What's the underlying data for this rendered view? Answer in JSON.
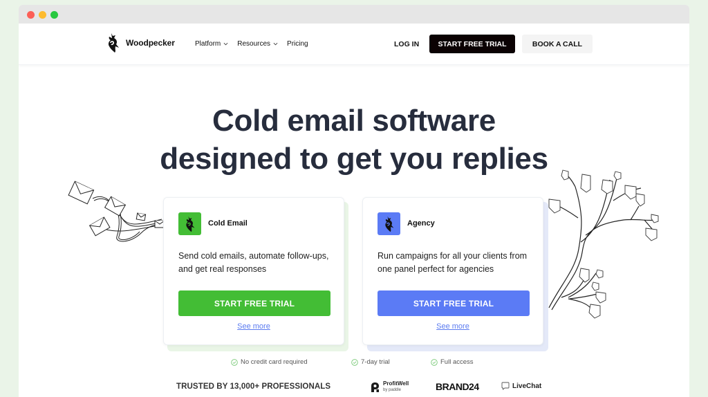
{
  "browser": {
    "window_controls": [
      "close",
      "minimize",
      "maximize"
    ]
  },
  "nav": {
    "brand": "Woodpecker",
    "menu": [
      {
        "label": "Platform",
        "has_dropdown": true
      },
      {
        "label": "Resources",
        "has_dropdown": true
      },
      {
        "label": "Pricing",
        "has_dropdown": false
      }
    ],
    "login_label": "LOG IN",
    "trial_label": "START FREE TRIAL",
    "call_label": "BOOK A CALL"
  },
  "hero": {
    "title_line1": "Cold email software",
    "title_line2": "designed to get you replies"
  },
  "cards": [
    {
      "title": "Cold Email",
      "description": "Send cold emails, automate follow-ups, and get real responses",
      "button_label": "START FREE TRIAL",
      "link_label": "See more",
      "accent": "#43bd35",
      "shadow_color": "#e9f5e6"
    },
    {
      "title": "Agency",
      "description": "Run campaigns for all your clients from one panel perfect for agencies",
      "button_label": "START FREE TRIAL",
      "link_label": "See more",
      "accent": "#5b7bf5",
      "shadow_color": "#e4e9f8"
    }
  ],
  "perks": [
    "No credit card required",
    "7-day trial",
    "Full access"
  ],
  "trusted": {
    "label": "TRUSTED BY 13,000+ PROFESSIONALS",
    "logos": [
      {
        "name": "ProfitWell",
        "sub": "by paddle"
      },
      {
        "name": "BRAND24"
      },
      {
        "name": "LiveChat"
      }
    ]
  },
  "colors": {
    "heading": "#272d3d",
    "dark_button": "#0b0203",
    "link": "#5b7bf0",
    "check": "#6cc46a"
  }
}
